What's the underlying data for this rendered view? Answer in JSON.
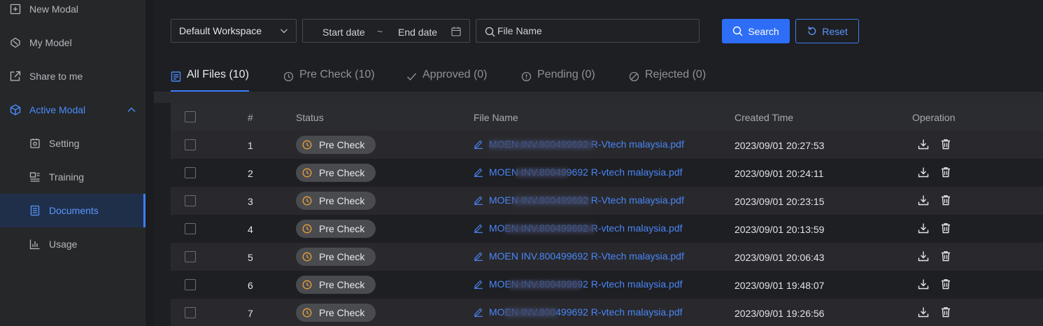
{
  "sidebar": {
    "items": [
      {
        "label": "New Modal",
        "icon": "plus-square-icon"
      },
      {
        "label": "My Model",
        "icon": "model-icon"
      },
      {
        "label": "Share to me",
        "icon": "share-icon"
      },
      {
        "label": "Active Modal",
        "icon": "cube-icon",
        "expanded": true
      },
      {
        "label": "Setting",
        "icon": "setting-icon"
      },
      {
        "label": "Training",
        "icon": "training-icon"
      },
      {
        "label": "Documents",
        "icon": "document-icon",
        "selected": true
      },
      {
        "label": "Usage",
        "icon": "chart-icon"
      }
    ]
  },
  "filters": {
    "workspace": "Default Workspace",
    "start_date": "Start date",
    "separator": "~",
    "end_date": "End date",
    "file_name_placeholder": "File Name",
    "search_label": "Search",
    "reset_label": "Reset"
  },
  "tabs": [
    {
      "label": "All Files (10)",
      "icon": "file-list-icon",
      "active": true
    },
    {
      "label": "Pre Check (10)",
      "icon": "clock-icon"
    },
    {
      "label": "Approved (0)",
      "icon": "check-icon"
    },
    {
      "label": "Pending (0)",
      "icon": "exclamation-circle-icon"
    },
    {
      "label": "Rejected (0)",
      "icon": "stop-icon"
    }
  ],
  "table": {
    "headers": {
      "num": "#",
      "status": "Status",
      "file": "File Name",
      "time": "Created Time",
      "op": "Operation"
    },
    "rows": [
      {
        "num": "1",
        "status": "Pre Check",
        "file": "MOEN INV.800499692 R-Vtech malaysia.pdf",
        "time": "2023/09/01 20:27:53"
      },
      {
        "num": "2",
        "status": "Pre Check",
        "file": "MOEN INV.800499692 R-vtech malaysia.pdf",
        "time": "2023/09/01 20:24:11"
      },
      {
        "num": "3",
        "status": "Pre Check",
        "file": "MOEN INV.800499692 R-Vtech malaysia.pdf",
        "time": "2023/09/01 20:23:15"
      },
      {
        "num": "4",
        "status": "Pre Check",
        "file": "MOEN INV.800499692 R-vtech malaysia.pdf",
        "time": "2023/09/01 20:13:59"
      },
      {
        "num": "5",
        "status": "Pre Check",
        "file": "MOEN INV.800499692 R-Vtech malaysia.pdf",
        "time": "2023/09/01 20:06:43"
      },
      {
        "num": "6",
        "status": "Pre Check",
        "file": "MOEN INV.800499692 R-vtech malaysia.pdf",
        "time": "2023/09/01 19:48:07"
      },
      {
        "num": "7",
        "status": "Pre Check",
        "file": "MOEN INV.800499692 R-vtech malaysia.pdf",
        "time": "2023/09/01 19:26:56"
      }
    ]
  },
  "colors": {
    "accent": "#2e6df6",
    "link": "#4a86f7",
    "status_icon": "#e6a23c"
  }
}
